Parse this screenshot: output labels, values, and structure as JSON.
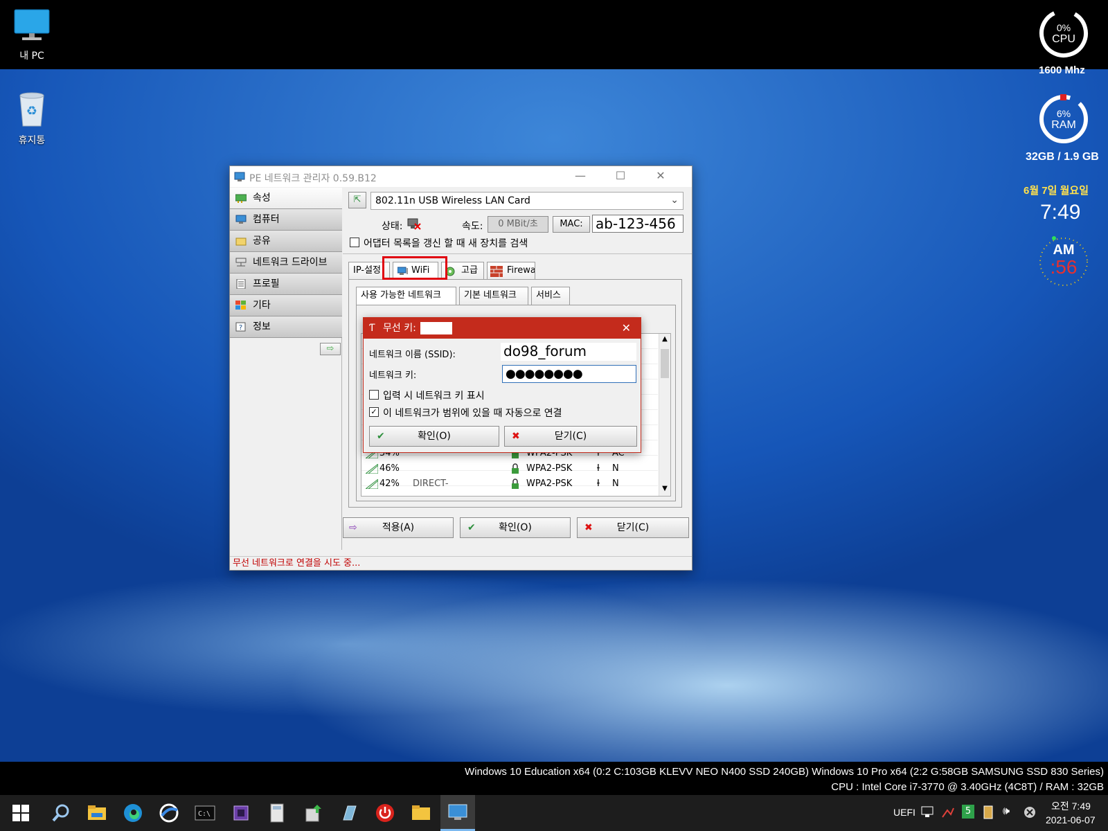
{
  "desktop": {
    "icons": [
      {
        "label": "내 PC"
      },
      {
        "label": "휴지통"
      }
    ]
  },
  "widgets": {
    "cpu": {
      "percent_text": "0%",
      "label": "CPU",
      "freq": "1600 Mhz",
      "level": 0.0
    },
    "ram": {
      "percent_text": "6%",
      "label": "RAM",
      "usage": "32GB / 1.9 GB",
      "level": 0.06
    },
    "date": "6월 7일 월요일",
    "time": "7:49",
    "ampm": "AM",
    "seconds": ":56"
  },
  "window": {
    "title": "PE 네트워크 관리자 0.59.B12",
    "nav": [
      {
        "label": "속성"
      },
      {
        "label": "컴퓨터"
      },
      {
        "label": "공유"
      },
      {
        "label": "네트워크 드라이브"
      },
      {
        "label": "프로필"
      },
      {
        "label": "기타"
      },
      {
        "label": "정보"
      }
    ],
    "adapter": "802.11n USB Wireless LAN Card",
    "status_label": "상태:",
    "speed_label": "속도:",
    "speed_value": "0 MBit/초",
    "mac_label": "MAC:",
    "mac_value": "ab-123-456",
    "refresh_checkbox": "어댑터 목록을 갱신 할 때 새 장치를 검색",
    "tabs": [
      "IP-설정",
      "WiFi",
      "고급",
      "Firewa"
    ],
    "subtabs": [
      "사용 가능한 네트워크",
      "기본 네트워크",
      "서비스"
    ],
    "networks": [
      {
        "signal": "54%",
        "ssid": "",
        "security": "WPA2-PSK",
        "mode": "AC"
      },
      {
        "signal": "46%",
        "ssid": "",
        "security": "WPA2-PSK",
        "mode": "N"
      },
      {
        "signal": "42%",
        "ssid": "DIRECT-",
        "security": "WPA2-PSK",
        "mode": "N"
      }
    ],
    "buttons": {
      "apply": "적용(A)",
      "ok": "확인(O)",
      "close": "닫기(C)"
    },
    "status_text": "무선 네트워크로 연결을 시도 중..."
  },
  "dialog": {
    "title": "무선 키:",
    "ssid_label": "네트워크 이름 (SSID):",
    "ssid_value": "do98_forum",
    "key_label": "네트워크 키:",
    "key_value": "●●●●●●●●",
    "show_key_label": "입력 시 네트워크 키 표시",
    "auto_connect_label": "이 네트워크가 범위에 있을 때 자동으로 연결",
    "ok_label": "확인(O)",
    "close_label": "닫기(C)"
  },
  "bottom_info": {
    "line1": "Windows 10 Education x64 (0:2 C:103GB KLEVV NEO N400 SSD 240GB) Windows 10 Pro x64 (2:2 G:58GB SAMSUNG SSD 830 Series)",
    "line2": "CPU : Intel Core i7-3770 @ 3.40GHz (4C8T) / RAM : 32GB"
  },
  "taskbar": {
    "tray_label": "UEFI",
    "badge": "5",
    "clock_time": "오전 7:49",
    "clock_date": "2021-06-07"
  },
  "colors": {
    "accent_red": "#c42b1c",
    "highlight": "#e0000f",
    "status_red": "#c00000",
    "date_yellow": "#ffe14d"
  }
}
